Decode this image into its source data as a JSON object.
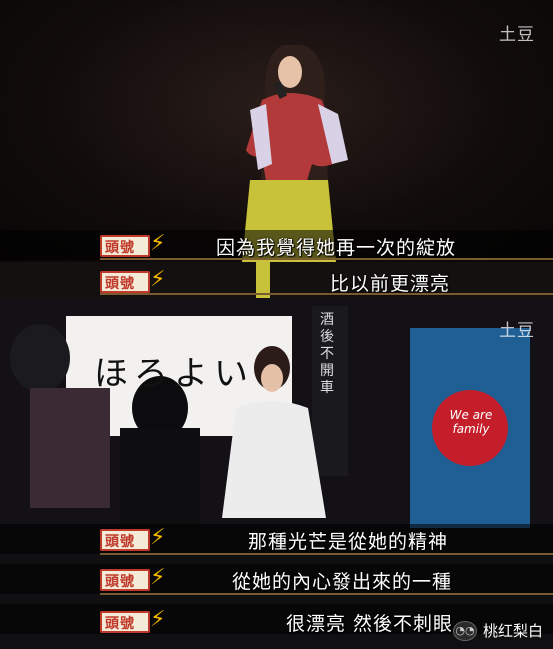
{
  "watermark": "土豆",
  "logo_text": "頭號",
  "subtitles": {
    "top_1": "因為我覺得她再一次的綻放",
    "top_2": "比以前更漂亮",
    "bottom_1": "那種光芒是從她的精神",
    "bottom_2": "從她的內心發出來的一種",
    "bottom_3": "很漂亮 然後不刺眼"
  },
  "banner_text": "ほろよい",
  "sign_text": "酒後不開車",
  "circle_text": "We are family",
  "brand": {
    "icon": "wechat-icon",
    "label": "桃红梨白"
  },
  "colors": {
    "accent_gold": "#f5b800",
    "logo_red": "#c0392b"
  }
}
